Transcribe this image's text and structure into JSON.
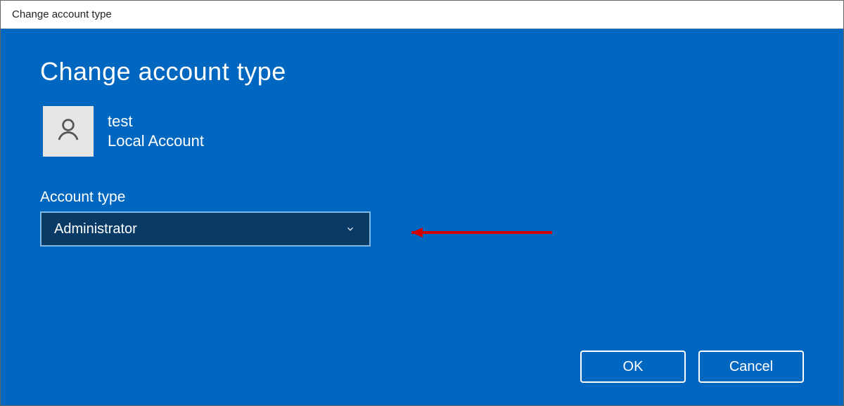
{
  "window": {
    "title": "Change account type"
  },
  "header": {
    "heading": "Change account type"
  },
  "user": {
    "name": "test",
    "account_kind": "Local Account"
  },
  "field": {
    "label": "Account type",
    "selected": "Administrator"
  },
  "buttons": {
    "ok": "OK",
    "cancel": "Cancel"
  },
  "colors": {
    "panel": "#0067c0",
    "select_bg": "#0a3b66",
    "select_border": "#7fb7e6",
    "annotation_arrow": "#d40000"
  }
}
